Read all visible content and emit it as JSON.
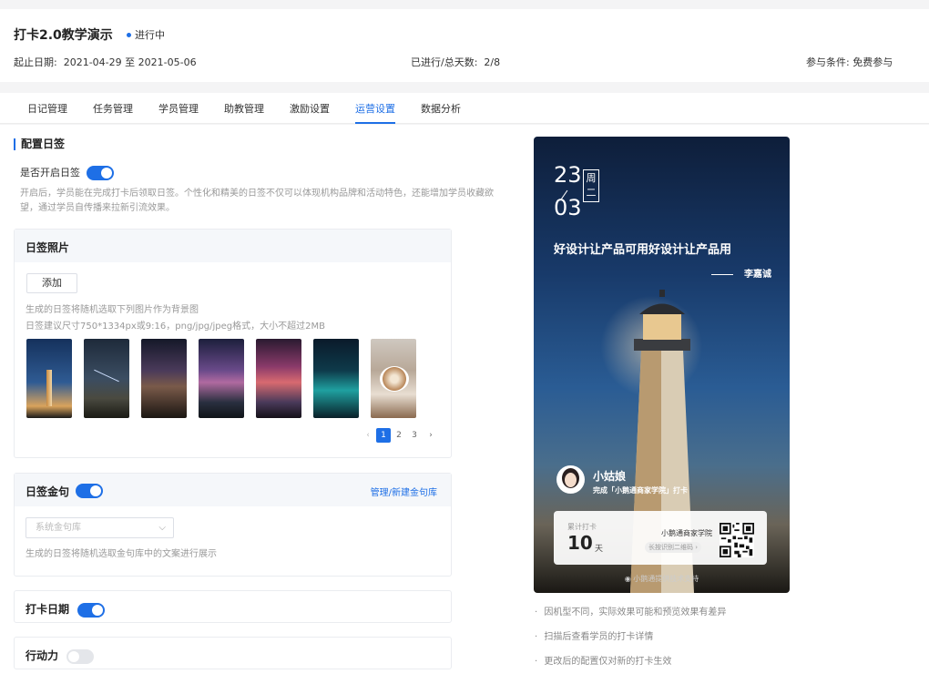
{
  "header": {
    "title": "打卡2.0教学演示",
    "status": "进行中",
    "date_label": "起止日期:",
    "date_value": "2021-04-29 至 2021-05-06",
    "progress_label": "已进行/总天数:",
    "progress_value": "2/8",
    "condition_label": "参与条件:",
    "condition_value": "免费参与"
  },
  "tabs": [
    {
      "label": "日记管理",
      "active": false
    },
    {
      "label": "任务管理",
      "active": false
    },
    {
      "label": "学员管理",
      "active": false
    },
    {
      "label": "助教管理",
      "active": false
    },
    {
      "label": "激励设置",
      "active": false
    },
    {
      "label": "运营设置",
      "active": true
    },
    {
      "label": "数据分析",
      "active": false
    }
  ],
  "config": {
    "section_title": "配置日签",
    "enable_label": "是否开启日签",
    "enable_on": true,
    "description": "开启后，学员能在完成打卡后领取日签。个性化和精美的日签不仅可以体现机构品牌和活动特色，还能增加学员收藏欲望，通过学员自传播来拉新引流效果。"
  },
  "photos": {
    "title": "日签照片",
    "add_label": "添加",
    "hint1": "生成的日签将随机选取下列图片作为背景图",
    "hint2": "日签建议尺寸750*1334px或9:16，png/jpg/jpeg格式，大小不超过2MB",
    "thumbnails": [
      "lighthouse",
      "night-sky-meteor",
      "milky-way-lake",
      "purple-galaxy-mountains",
      "pink-galaxy-silhouette",
      "teal-aurora",
      "latte-art"
    ],
    "pagination": {
      "prev": "‹",
      "pages": [
        "1",
        "2",
        "3"
      ],
      "current": "1",
      "next": "›"
    }
  },
  "golden": {
    "title": "日签金句",
    "enabled": true,
    "manage_link": "管理/新建金句库",
    "select_placeholder": "系统金句库",
    "hint": "生成的日签将随机选取金句库中的文案进行展示"
  },
  "date_card": {
    "title": "打卡日期",
    "enabled": true
  },
  "action_card": {
    "title": "行动力",
    "enabled": false
  },
  "poster": {
    "day": "23",
    "month": "03",
    "weekday": "周二",
    "quote": "好设计让产品可用好设计让产品用",
    "author": "李嘉诚",
    "user_name": "小姑娘",
    "completed_text": "完成「小鹅通商家学院」打卡",
    "total_label": "累计打卡",
    "total_value": "10",
    "total_unit": "天",
    "brand": "小鹅通商家学院",
    "scan_text": "长按识别二维码",
    "footer": "小鹅通提供技术支持"
  },
  "notes": [
    "因机型不同，实际效果可能和预览效果有差异",
    "扫描后查看学员的打卡详情",
    "更改后的配置仅对新的打卡生效"
  ],
  "colors": {
    "accent": "#1e6fe6"
  }
}
